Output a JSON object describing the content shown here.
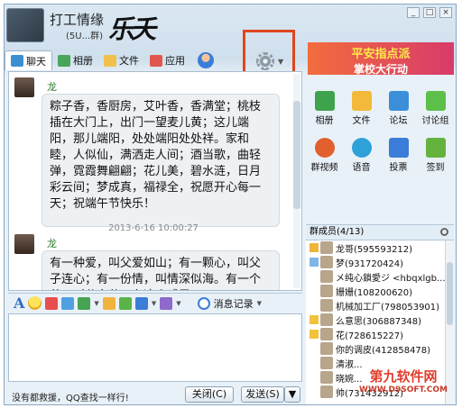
{
  "header": {
    "group_title": "打工情缘",
    "group_sub": "(5U...群)",
    "brush_text": "乐夭"
  },
  "window_controls": [
    "_",
    "□",
    "×"
  ],
  "toolbar": {
    "tabs": [
      {
        "label": "聊天",
        "icon": "chat-icon"
      },
      {
        "label": "相册",
        "icon": "album-icon"
      },
      {
        "label": "文件",
        "icon": "folder-icon"
      },
      {
        "label": "应用",
        "icon": "apps-icon"
      }
    ]
  },
  "ad_banner": {
    "line1": "平安指点派",
    "line2": "掌校大行动"
  },
  "messages": [
    {
      "sender": "龙哥",
      "text": "粽子香，香厨房，艾叶香，香满堂；桃枝插在大门上，出门一望麦儿黄；这儿端阳，那儿端阳，处处端阳处处祥。家和睦，人似仙，满洒走人间；酒当歌，曲轻弹，霓霞舞翩翩；花儿美，碧水涟，日月彩云间；梦成真，福禄全，祝愿开心每一天；祝端午节快乐！",
      "time": "2013-6-16 10:00:27"
    },
    {
      "sender": "龙哥",
      "text": "有一种爱，叫父爱如山；有一颗心，叫父子连心；有一份情，叫情深似海。有一个节，叫父亲节。在这个感恩"
    }
  ],
  "input_toolbar": {
    "history_label": "消息记录"
  },
  "bottom": {
    "ad_text": "没有都救援，QQ查找一样行!",
    "close_label": "关闭(C)",
    "send_label": "发送(S)"
  },
  "apps": [
    {
      "label": "相册",
      "icon": "album-icon",
      "color": "#3fa34d"
    },
    {
      "label": "文件",
      "icon": "folder-icon",
      "color": "#f2b93b"
    },
    {
      "label": "论坛",
      "icon": "forum-icon",
      "color": "#3b8fd9"
    },
    {
      "label": "讨论组",
      "icon": "discussion-icon",
      "color": "#5cbf4a"
    },
    {
      "label": "群视频",
      "icon": "video-icon",
      "color": "#e2602d"
    },
    {
      "label": "语音",
      "icon": "voice-icon",
      "color": "#2fa1d9"
    },
    {
      "label": "投票",
      "icon": "vote-icon",
      "color": "#3b7dd8"
    },
    {
      "label": "签到",
      "icon": "checkin-icon",
      "color": "#65b33f"
    }
  ],
  "members_header": "群成员(4/13)",
  "members": [
    {
      "name": "龙哥(595593212)",
      "badge": "owner"
    },
    {
      "name": "梦(931720424)",
      "badge": "admin"
    },
    {
      "name": "メ纯心鎖愛ジ <hbqxlgb...",
      "badge": ""
    },
    {
      "name": "姗姗(108200620)",
      "badge": ""
    },
    {
      "name": "机械加工厂(798053901)",
      "badge": ""
    },
    {
      "name": "么意思(306887348)",
      "badge": "star"
    },
    {
      "name": "花(728615227)",
      "badge": "star"
    },
    {
      "name": "你的调皮(412858478)",
      "badge": ""
    },
    {
      "name": "清淑...",
      "badge": ""
    },
    {
      "name": "晓婉...",
      "badge": ""
    },
    {
      "name": "帅(731432912)",
      "badge": ""
    }
  ],
  "watermark": {
    "line1": "第九软件网",
    "line2": "WWW.D9SOFT.COM"
  }
}
